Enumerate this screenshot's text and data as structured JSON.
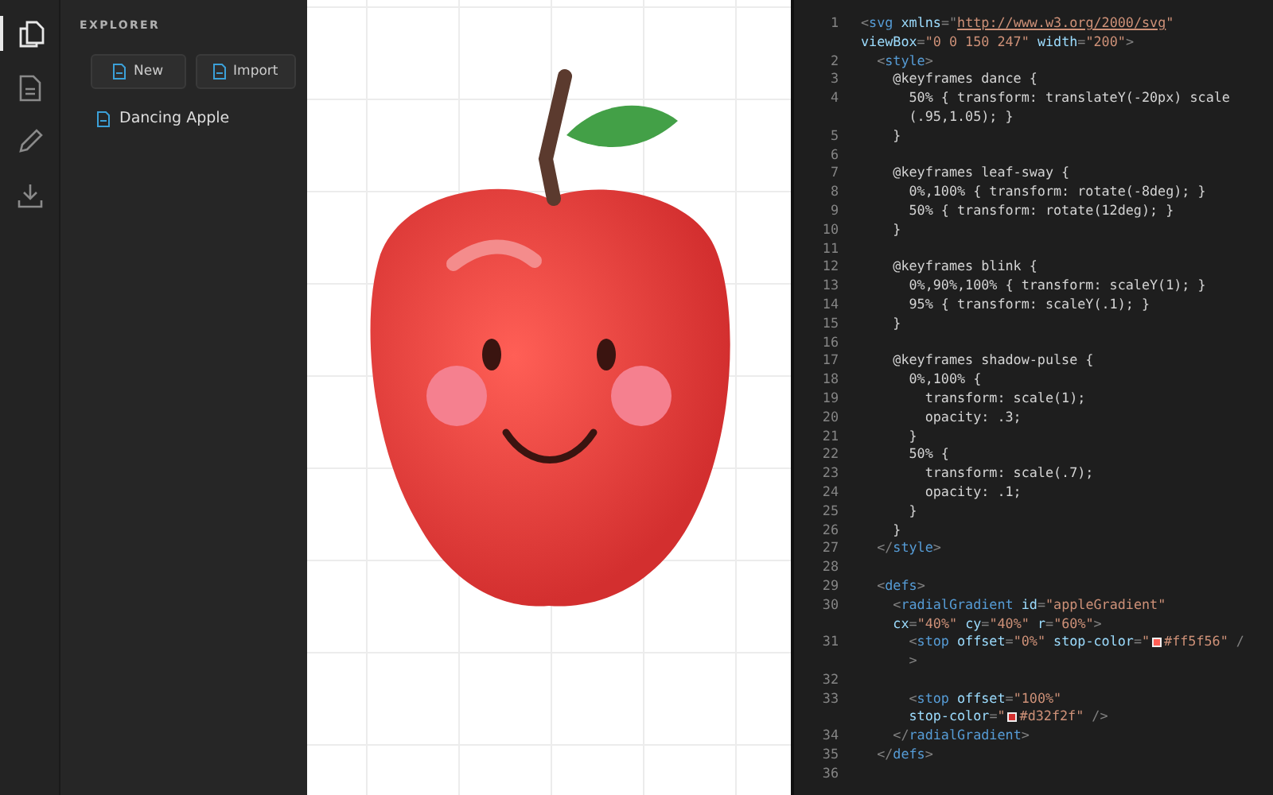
{
  "activity_bar": [
    {
      "kind": "files",
      "selected": true
    },
    {
      "kind": "document",
      "selected": false
    },
    {
      "kind": "pencil",
      "selected": false
    },
    {
      "kind": "download",
      "selected": false
    }
  ],
  "explorer": {
    "title": "EXPLORER",
    "buttons": [
      "New",
      "Import"
    ],
    "files": [
      {
        "name": "Dancing Apple"
      }
    ]
  },
  "editor": {
    "lines": [
      {
        "number": "1",
        "parts": [
          {
            "kind": "punct",
            "text": "<"
          },
          {
            "kind": "tag",
            "text": "svg"
          },
          {
            "kind": "attr",
            "text": " xmlns"
          },
          {
            "kind": "punct",
            "text": "=\""
          },
          {
            "kind": "link",
            "text": "http://www.w3.org/2000/svg"
          },
          {
            "kind": "string",
            "text": "\""
          }
        ]
      },
      {
        "parts": [
          {
            "kind": "attr",
            "text": "viewBox"
          },
          {
            "kind": "punct",
            "text": "="
          },
          {
            "kind": "string",
            "text": "\"0 0 150 247\""
          },
          {
            "kind": "attr",
            "text": " width"
          },
          {
            "kind": "punct",
            "text": "="
          },
          {
            "kind": "string",
            "text": "\"200\""
          },
          {
            "kind": "punct",
            "text": ">"
          }
        ]
      },
      {
        "number": "2",
        "parts": [
          {
            "kind": "punct",
            "text": "  <"
          },
          {
            "kind": "tag",
            "text": "style"
          },
          {
            "kind": "punct",
            "text": ">"
          }
        ]
      },
      {
        "number": "3",
        "parts": [
          {
            "kind": "plain",
            "text": "    @keyframes dance {"
          }
        ]
      },
      {
        "number": "4",
        "parts": [
          {
            "kind": "plain",
            "text": "      50% { transform: translateY(-20px) scale"
          }
        ]
      },
      {
        "parts": [
          {
            "kind": "plain",
            "text": "      (.95,1.05); }"
          }
        ]
      },
      {
        "number": "5",
        "parts": [
          {
            "kind": "plain",
            "text": "    }"
          }
        ]
      },
      {
        "number": "6"
      },
      {
        "number": "7",
        "parts": [
          {
            "kind": "plain",
            "text": "    @keyframes leaf-sway {"
          }
        ]
      },
      {
        "number": "8",
        "parts": [
          {
            "kind": "plain",
            "text": "      0%,100% { transform: rotate(-8deg); }"
          }
        ]
      },
      {
        "number": "9",
        "parts": [
          {
            "kind": "plain",
            "text": "      50% { transform: rotate(12deg); }"
          }
        ]
      },
      {
        "number": "10",
        "parts": [
          {
            "kind": "plain",
            "text": "    }"
          }
        ]
      },
      {
        "number": "11"
      },
      {
        "number": "12",
        "parts": [
          {
            "kind": "plain",
            "text": "    @keyframes blink {"
          }
        ]
      },
      {
        "number": "13",
        "parts": [
          {
            "kind": "plain",
            "text": "      0%,90%,100% { transform: scaleY(1); }"
          }
        ]
      },
      {
        "number": "14",
        "parts": [
          {
            "kind": "plain",
            "text": "      95% { transform: scaleY(.1); }"
          }
        ]
      },
      {
        "number": "15",
        "parts": [
          {
            "kind": "plain",
            "text": "    }"
          }
        ]
      },
      {
        "number": "16"
      },
      {
        "number": "17",
        "parts": [
          {
            "kind": "plain",
            "text": "    @keyframes shadow-pulse {"
          }
        ]
      },
      {
        "number": "18",
        "parts": [
          {
            "kind": "plain",
            "text": "      0%,100% {"
          }
        ]
      },
      {
        "number": "19",
        "parts": [
          {
            "kind": "plain",
            "text": "        transform: scale(1);"
          }
        ]
      },
      {
        "number": "20",
        "parts": [
          {
            "kind": "plain",
            "text": "        opacity: .3;"
          }
        ]
      },
      {
        "number": "21",
        "parts": [
          {
            "kind": "plain",
            "text": "      }"
          }
        ]
      },
      {
        "number": "22",
        "parts": [
          {
            "kind": "plain",
            "text": "      50% {"
          }
        ]
      },
      {
        "number": "23",
        "parts": [
          {
            "kind": "plain",
            "text": "        transform: scale(.7);"
          }
        ]
      },
      {
        "number": "24",
        "parts": [
          {
            "kind": "plain",
            "text": "        opacity: .1;"
          }
        ]
      },
      {
        "number": "25",
        "parts": [
          {
            "kind": "plain",
            "text": "      }"
          }
        ]
      },
      {
        "number": "26",
        "parts": [
          {
            "kind": "plain",
            "text": "    }"
          }
        ]
      },
      {
        "number": "27",
        "parts": [
          {
            "kind": "punct",
            "text": "  </"
          },
          {
            "kind": "tag",
            "text": "style"
          },
          {
            "kind": "punct",
            "text": ">"
          }
        ]
      },
      {
        "number": "28"
      },
      {
        "number": "29",
        "parts": [
          {
            "kind": "punct",
            "text": "  <"
          },
          {
            "kind": "tag",
            "text": "defs"
          },
          {
            "kind": "punct",
            "text": ">"
          }
        ]
      },
      {
        "number": "30",
        "parts": [
          {
            "kind": "punct",
            "text": "    <"
          },
          {
            "kind": "tag",
            "text": "radialGradient"
          },
          {
            "kind": "attr",
            "text": " id"
          },
          {
            "kind": "punct",
            "text": "="
          },
          {
            "kind": "string",
            "text": "\"appleGradient\""
          }
        ]
      },
      {
        "parts": [
          {
            "kind": "attr",
            "text": "    cx"
          },
          {
            "kind": "punct",
            "text": "="
          },
          {
            "kind": "string",
            "text": "\"40%\""
          },
          {
            "kind": "attr",
            "text": " cy"
          },
          {
            "kind": "punct",
            "text": "="
          },
          {
            "kind": "string",
            "text": "\"40%\""
          },
          {
            "kind": "attr",
            "text": " r"
          },
          {
            "kind": "punct",
            "text": "="
          },
          {
            "kind": "string",
            "text": "\"60%\""
          },
          {
            "kind": "punct",
            "text": ">"
          }
        ]
      },
      {
        "number": "31",
        "parts": [
          {
            "kind": "punct",
            "text": "      <"
          },
          {
            "kind": "tag",
            "text": "stop"
          },
          {
            "kind": "attr",
            "text": " offset"
          },
          {
            "kind": "punct",
            "text": "="
          },
          {
            "kind": "string",
            "text": "\"0%\""
          },
          {
            "kind": "attr",
            "text": " stop-color"
          },
          {
            "kind": "punct",
            "text": "="
          },
          {
            "kind": "string",
            "text": "\""
          },
          {
            "kind": "swatch",
            "color": "#ff5f56"
          },
          {
            "kind": "string",
            "text": "#ff5f56\""
          },
          {
            "kind": "punct",
            "text": " /"
          }
        ]
      },
      {
        "parts": [
          {
            "kind": "punct",
            "text": "      >"
          }
        ]
      },
      {
        "number": "32"
      },
      {
        "number": "33",
        "parts": [
          {
            "kind": "punct",
            "text": "      <"
          },
          {
            "kind": "tag",
            "text": "stop"
          },
          {
            "kind": "attr",
            "text": " offset"
          },
          {
            "kind": "punct",
            "text": "="
          },
          {
            "kind": "string",
            "text": "\"100%\""
          }
        ]
      },
      {
        "parts": [
          {
            "kind": "attr",
            "text": "      stop-color"
          },
          {
            "kind": "punct",
            "text": "="
          },
          {
            "kind": "string",
            "text": "\""
          },
          {
            "kind": "swatch",
            "color": "#d32f2f"
          },
          {
            "kind": "string",
            "text": "#d32f2f\""
          },
          {
            "kind": "punct",
            "text": " />"
          }
        ]
      },
      {
        "number": "34",
        "parts": [
          {
            "kind": "punct",
            "text": "    </"
          },
          {
            "kind": "tag",
            "text": "radialGradient"
          },
          {
            "kind": "punct",
            "text": ">"
          }
        ]
      },
      {
        "number": "35",
        "parts": [
          {
            "kind": "punct",
            "text": "  </"
          },
          {
            "kind": "tag",
            "text": "defs"
          },
          {
            "kind": "punct",
            "text": ">"
          }
        ]
      },
      {
        "number": "36"
      }
    ]
  }
}
